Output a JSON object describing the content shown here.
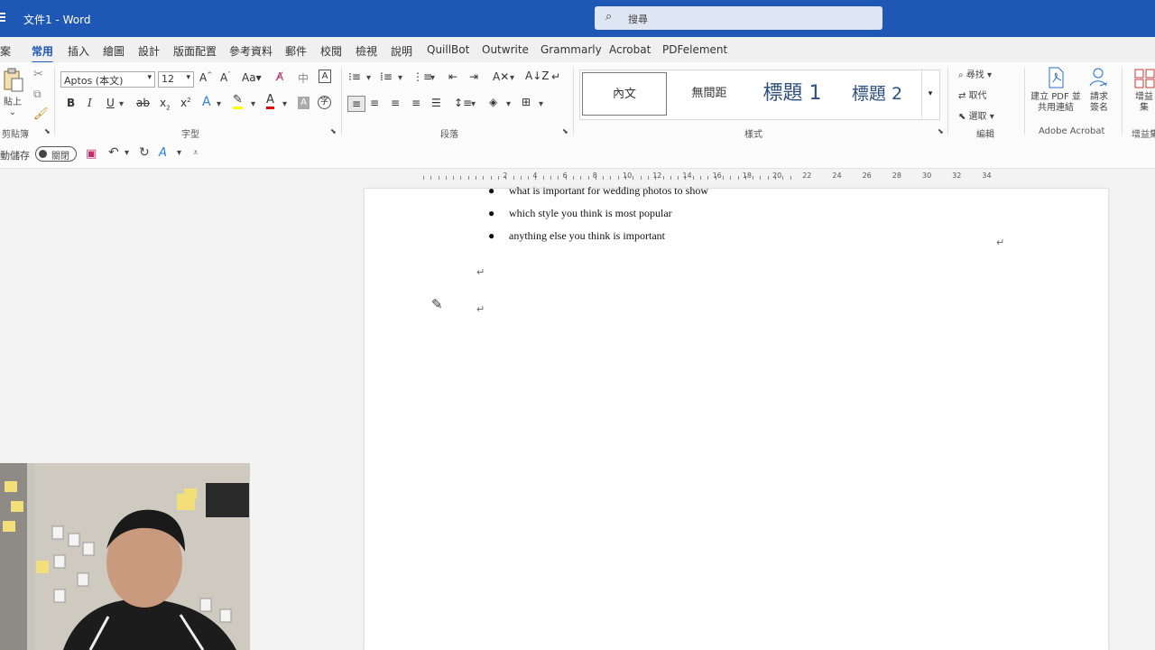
{
  "app": {
    "title": "文件1 - Word"
  },
  "search": {
    "placeholder": "搜尋"
  },
  "tabs": [
    {
      "label": "檔案"
    },
    {
      "label": "常用"
    },
    {
      "label": "插入"
    },
    {
      "label": "繪圖"
    },
    {
      "label": "設計"
    },
    {
      "label": "版面配置"
    },
    {
      "label": "參考資料"
    },
    {
      "label": "郵件"
    },
    {
      "label": "校閱"
    },
    {
      "label": "檢視"
    },
    {
      "label": "說明"
    },
    {
      "label": "QuillBot"
    },
    {
      "label": "Outwrite"
    },
    {
      "label": "Grammarly"
    },
    {
      "label": "Acrobat"
    },
    {
      "label": "PDFelement"
    }
  ],
  "ribbon": {
    "clipboard": {
      "paste_label": "貼上",
      "group_label": "剪貼簿"
    },
    "font": {
      "name": "Aptos (本文)",
      "size": "12",
      "group_label": "字型"
    },
    "paragraph": {
      "group_label": "段落"
    },
    "styles": {
      "items": [
        "內文",
        "無間距",
        "標題 1",
        "標題 2"
      ],
      "group_label": "樣式"
    },
    "editing": {
      "find": "尋找",
      "replace": "取代",
      "select": "選取",
      "group_label": "編輯"
    },
    "acrobat": {
      "create_pdf": "建立 PDF 並共用連結",
      "request_sign": "請求簽名",
      "group_label": "Adobe Acrobat"
    },
    "addins": {
      "label": "增益集",
      "group_label": "增益集"
    }
  },
  "qat": {
    "autosave_label": "自動儲存",
    "toggle_state": "關閉"
  },
  "document": {
    "bullets": [
      "what is important for wedding photos to show",
      "which style you think is most popular",
      "anything else you think is important"
    ]
  },
  "colors": {
    "accent": "#1f57b5",
    "highlight": "#ffff00",
    "font_color": "#e00000"
  }
}
